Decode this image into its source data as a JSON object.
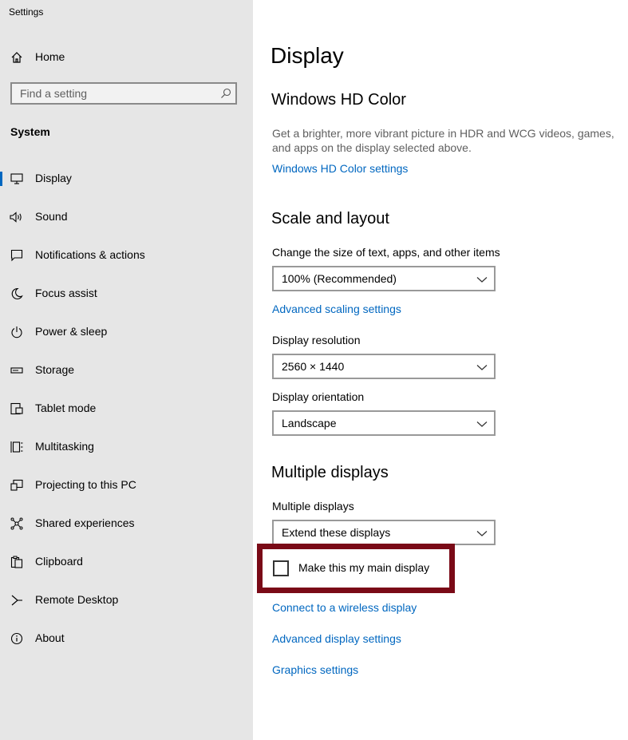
{
  "window": {
    "title": "Settings"
  },
  "sidebar": {
    "home_label": "Home",
    "search_placeholder": "Find a setting",
    "section_label": "System",
    "items": [
      {
        "label": "Display",
        "icon": "monitor-icon",
        "active": true
      },
      {
        "label": "Sound",
        "icon": "speaker-icon"
      },
      {
        "label": "Notifications & actions",
        "icon": "notification-icon"
      },
      {
        "label": "Focus assist",
        "icon": "moon-icon"
      },
      {
        "label": "Power & sleep",
        "icon": "power-icon"
      },
      {
        "label": "Storage",
        "icon": "storage-icon"
      },
      {
        "label": "Tablet mode",
        "icon": "tablet-icon"
      },
      {
        "label": "Multitasking",
        "icon": "multitasking-icon"
      },
      {
        "label": "Projecting to this PC",
        "icon": "projecting-icon"
      },
      {
        "label": "Shared experiences",
        "icon": "shared-icon"
      },
      {
        "label": "Clipboard",
        "icon": "clipboard-icon"
      },
      {
        "label": "Remote Desktop",
        "icon": "remote-desktop-icon"
      },
      {
        "label": "About",
        "icon": "info-icon"
      }
    ]
  },
  "main": {
    "page_title": "Display",
    "hd_color": {
      "heading": "Windows HD Color",
      "description": "Get a brighter, more vibrant picture in HDR and WCG videos, games, and apps on the display selected above.",
      "link": "Windows HD Color settings"
    },
    "scale_layout": {
      "heading": "Scale and layout",
      "size_label": "Change the size of text, apps, and other items",
      "size_value": "100% (Recommended)",
      "advanced_link": "Advanced scaling settings",
      "resolution_label": "Display resolution",
      "resolution_value": "2560 × 1440",
      "orientation_label": "Display orientation",
      "orientation_value": "Landscape"
    },
    "multiple_displays": {
      "heading": "Multiple displays",
      "label": "Multiple displays",
      "value": "Extend these displays",
      "main_display_checkbox": "Make this my main display",
      "main_display_checked": false,
      "wireless_link": "Connect to a wireless display",
      "advanced_link": "Advanced display settings",
      "graphics_link": "Graphics settings"
    }
  },
  "colors": {
    "accent": "#0067c0",
    "sidebar_bg": "#e6e6e6",
    "highlight_border": "#7a0a17"
  }
}
